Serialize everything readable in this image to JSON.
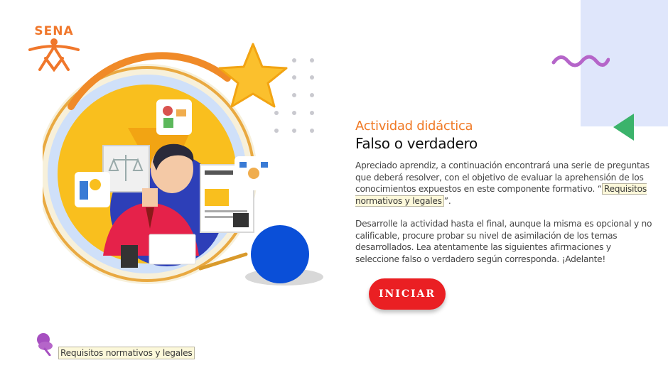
{
  "logo": {
    "text": "SENA",
    "icon": "sena-logo-icon",
    "color": "#f0772b"
  },
  "content": {
    "label": "Actividad didáctica",
    "title": "Falso o verdadero",
    "paragraph1_before": "Apreciado aprendiz, a continuación encontrará una serie de preguntas que deberá resolver, con el objetivo de evaluar la aprehensión de los conocimientos expuestos en este componente formativo. “",
    "paragraph1_link": "Requisitos normativos y legales",
    "paragraph1_after": "”.",
    "paragraph2": "Desarrolle la actividad hasta el final, aunque la misma es opcional y no calificable, procure probar su nivel de asimilación de los temas desarrollados.  Lea atentamente las siguientes afirmaciones y seleccione falso o verdadero según corresponda. ¡Adelante!"
  },
  "button": {
    "label": "INICIAR",
    "color": "#ea1f23"
  },
  "bottom": {
    "icon": "pushpin-icon",
    "link_text": "Requisitos normativos y legales"
  },
  "colors": {
    "accent_orange": "#f07a26",
    "lavender": "#dfe6fb",
    "squiggle": "#b565c9",
    "triangle": "#3bb36b",
    "blue_circle": "#0a4fd8",
    "yellow": "#f9bf1e"
  }
}
